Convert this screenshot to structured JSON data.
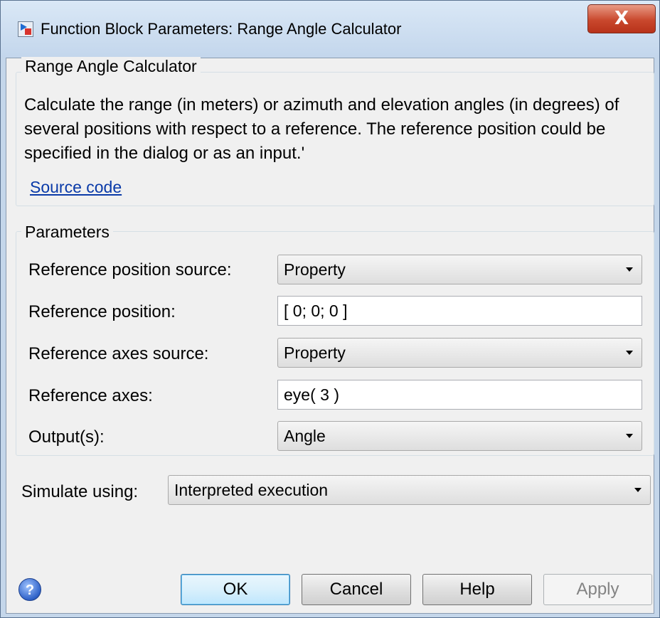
{
  "window": {
    "title": "Function Block Parameters: Range Angle Calculator",
    "close_label": "X"
  },
  "description_group": {
    "title": "Range Angle Calculator",
    "text": "Calculate the range (in meters) or azimuth and elevation angles (in degrees) of several positions with respect to a reference. The reference position could be specified in the dialog or as an input.'",
    "link_label": "Source code"
  },
  "parameters_group": {
    "title": "Parameters",
    "ref_pos_source": {
      "label": "Reference position source:",
      "value": "Property"
    },
    "ref_pos": {
      "label": "Reference position:",
      "value": "[ 0; 0; 0 ]"
    },
    "ref_axes_source": {
      "label": "Reference axes source:",
      "value": "Property"
    },
    "ref_axes": {
      "label": "Reference axes:",
      "value": "eye( 3 )"
    },
    "outputs": {
      "label": "Output(s):",
      "value": "Angle"
    }
  },
  "simulate": {
    "label": "Simulate using:",
    "value": "Interpreted execution"
  },
  "buttons": {
    "help_icon": "?",
    "ok": "OK",
    "cancel": "Cancel",
    "help": "Help",
    "apply": "Apply"
  },
  "icons": [
    "simulink-block-icon",
    "close-icon",
    "dropdown-arrow-icon",
    "help-icon"
  ]
}
